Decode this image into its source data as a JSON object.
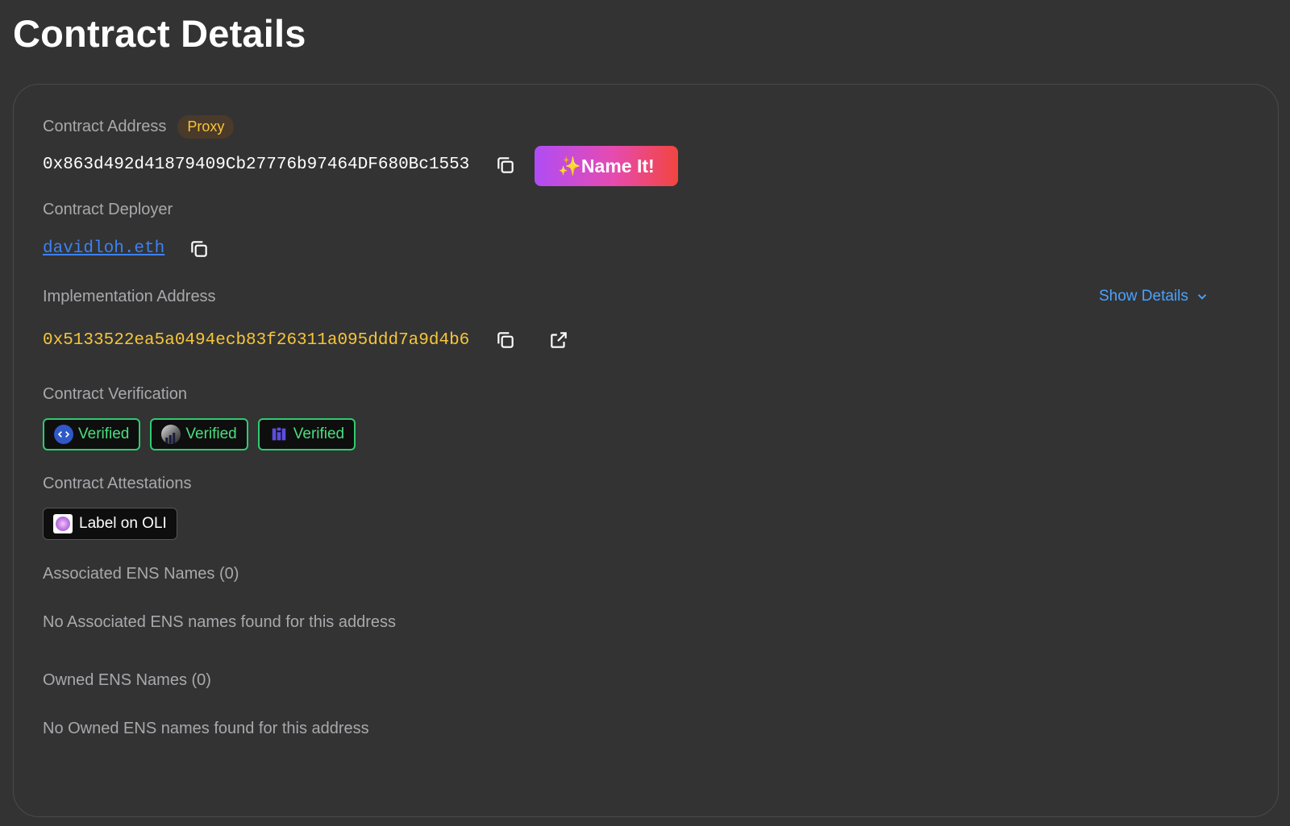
{
  "page": {
    "title": "Contract Details"
  },
  "contract": {
    "address_label": "Contract Address",
    "proxy_badge": "Proxy",
    "address": "0x863d492d41879409Cb27776b97464DF680Bc1553",
    "name_it_label": "✨Name It!",
    "deployer_label": "Contract Deployer",
    "deployer": "davidloh.eth",
    "implementation_label": "Implementation Address",
    "show_details_label": "Show Details",
    "implementation_address": "0x5133522ea5a0494ecb83f26311a095ddd7a9d4b6",
    "verification_label": "Contract Verification",
    "verifications": [
      {
        "label": "Verified",
        "icon": "sourcify-icon",
        "color": "#2f59c7"
      },
      {
        "label": "Verified",
        "icon": "blockscout-icon",
        "color": "#6b6b6b"
      },
      {
        "label": "Verified",
        "icon": "routescan-icon",
        "color": "#5b4ee0"
      }
    ],
    "attestations_label": "Contract Attestations",
    "attestation_button": "Label on OLI",
    "associated_ens_label": "Associated ENS Names (0)",
    "associated_ens_empty": "No Associated ENS names found for this address",
    "owned_ens_label": "Owned ENS Names (0)",
    "owned_ens_empty": "No Owned ENS names found for this address"
  },
  "colors": {
    "background": "#333333",
    "accent_link": "#3b82f6",
    "implementation": "#f6c53a",
    "verified_green": "#2ecc71",
    "proxy_text": "#f6c53a"
  }
}
